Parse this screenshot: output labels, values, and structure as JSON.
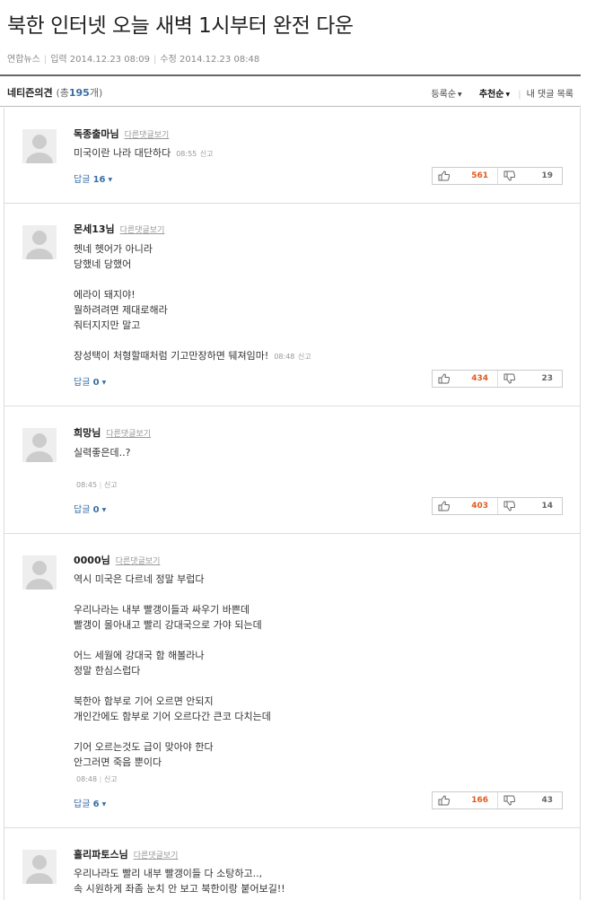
{
  "article": {
    "title": "북한 인터넷 오늘 새벽 1시부터 완전 다운",
    "source": "연합뉴스",
    "input_label": "입력",
    "input_time": "2014.12.23 08:09",
    "edit_label": "수정",
    "edit_time": "2014.12.23 08:48"
  },
  "comments_bar": {
    "label": "네티즌의견",
    "count_prefix": "(총",
    "count": "195",
    "count_suffix": "개)",
    "sort_options": [
      "등록순",
      "추천순"
    ],
    "my_comments": "내 댓글 목록"
  },
  "other_comments_label": "다른댓글보기",
  "report_label": "신고",
  "reply_label": "답글",
  "comments": [
    {
      "author": "독종출마님",
      "text": "미국이란 나라 대단하다",
      "time": "08:55",
      "replies": "16",
      "up": "561",
      "down": "19"
    },
    {
      "author": "몬세13님",
      "text": "헷네 헷어가 아니라\n당했네 당했어\n\n에라이 돼지야!\n뭘하려려면 제대로해라\n줘터지지만 말고\n\n장성택이 처형할때처럼 기고만장하면 뒈져임마!",
      "time": "08:48",
      "replies": "0",
      "up": "434",
      "down": "23"
    },
    {
      "author": "희망님",
      "text": "실력좋은데..?",
      "time": "08:45",
      "replies": "0",
      "up": "403",
      "down": "14"
    },
    {
      "author": "0000님",
      "text": "역시 미국은 다르네 정말 부럽다\n\n우리나라는 내부 빨갱이들과 싸우기 바쁜데\n빨갱이 몰아내고 빨리 강대국으로 가야 되는데\n\n어느 세월에 강대국 함 해볼라나\n정말 한심스럽다\n\n북한아 함부로 기어 오르면 안되지\n개인간에도 함부로 기어 오르다간 큰코 다치는데\n\n기어 오르는것도 급이 맞아야 한다\n안그러면 죽음 뿐이다",
      "time": "08:48",
      "replies": "6",
      "up": "166",
      "down": "43"
    },
    {
      "author": "홀리파토스님",
      "text": "우리나라도 빨리 내부 빨갱이들 다 소탕하고..,\n속 시원하게 좌좀 눈치 안 보고 북한이랑 붙어보길!!",
      "time": "",
      "replies": "",
      "up": "",
      "down": ""
    }
  ]
}
